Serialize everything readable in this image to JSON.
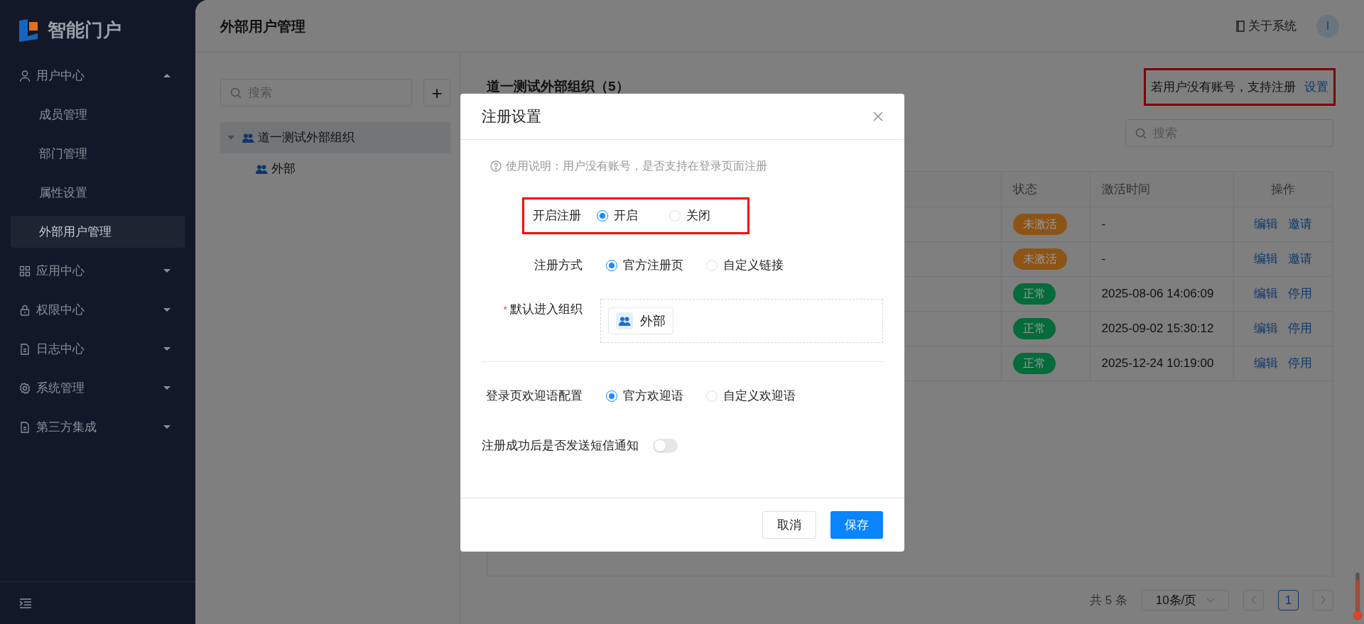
{
  "sidebar": {
    "logo": "智能门户",
    "menu": [
      {
        "label": "用户中心",
        "expanded": true,
        "selected": false,
        "children": [
          {
            "label": "成员管理",
            "selected": false
          },
          {
            "label": "部门管理",
            "selected": false
          },
          {
            "label": "属性设置",
            "selected": false
          },
          {
            "label": "外部用户管理",
            "selected": true
          }
        ]
      },
      {
        "label": "应用中心",
        "expanded": false,
        "selected": false
      },
      {
        "label": "权限中心",
        "expanded": false,
        "selected": false
      },
      {
        "label": "日志中心",
        "expanded": false,
        "selected": false
      },
      {
        "label": "系统管理",
        "expanded": false,
        "selected": false
      },
      {
        "label": "第三方集成",
        "expanded": false,
        "selected": false
      }
    ]
  },
  "header": {
    "title": "外部用户管理",
    "about": "关于系统",
    "avatar": "I"
  },
  "tree": {
    "search": {
      "placeholder": "搜索"
    },
    "add_button": "+",
    "nodes": [
      {
        "label": "道一测试外部组织",
        "expanded": true,
        "selected": true,
        "children": [
          {
            "label": "外部",
            "selected": false
          }
        ]
      }
    ]
  },
  "panel": {
    "title": "道一测试外部组织（5）",
    "notice": "若用户没有账号，支持注册",
    "notice_link": "设置",
    "search": {
      "placeholder": "搜索"
    },
    "table": {
      "columns": [
        "状态",
        "激活时间",
        "操作"
      ],
      "rows": [
        {
          "status": "未激活",
          "color": "#8c5417",
          "activated": "-",
          "actions": [
            "编辑",
            "邀请"
          ]
        },
        {
          "status": "未激活",
          "color": "#8c5417",
          "activated": "-",
          "actions": [
            "编辑",
            "邀请"
          ]
        },
        {
          "status": "正常",
          "color": "#056b3a",
          "activated": "2025-08-06 14:06:09",
          "actions": [
            "编辑",
            "停用"
          ]
        },
        {
          "status": "正常",
          "color": "#056b3a",
          "activated": "2025-09-02 15:30:12",
          "actions": [
            "编辑",
            "停用"
          ]
        },
        {
          "status": "正常",
          "color": "#056b3a",
          "activated": "2025-12-24 10:19:00",
          "actions": [
            "编辑",
            "停用"
          ]
        }
      ]
    },
    "pagination": {
      "total": "共 5 条",
      "page_size": "10条/页",
      "pages": [
        {
          "label": "1",
          "selected": true
        }
      ]
    }
  },
  "dialog": {
    "title": "注册设置",
    "help": "使用说明：用户没有账号，是否支持在登录页面注册",
    "fields": [
      {
        "kind": "radio",
        "label": "开启注册",
        "highlighted": true,
        "options": [
          {
            "label": "开启",
            "selected": true
          },
          {
            "label": "关闭",
            "selected": false
          }
        ]
      },
      {
        "kind": "radio",
        "label": "注册方式",
        "highlighted": false,
        "options": [
          {
            "label": "官方注册页",
            "selected": true
          },
          {
            "label": "自定义链接",
            "selected": false
          }
        ]
      },
      {
        "kind": "org",
        "label": "默认进入组织",
        "required_mark": "*",
        "value": "外部"
      },
      {
        "kind": "divider"
      },
      {
        "kind": "radio",
        "label": "登录页欢迎语配置",
        "highlighted": false,
        "options": [
          {
            "label": "官方欢迎语",
            "selected": true
          },
          {
            "label": "自定义欢迎语",
            "selected": false
          }
        ]
      },
      {
        "kind": "switch",
        "label": "注册成功后是否发送短信通知",
        "on": false
      }
    ],
    "buttons": [
      "取消",
      "保存"
    ]
  }
}
